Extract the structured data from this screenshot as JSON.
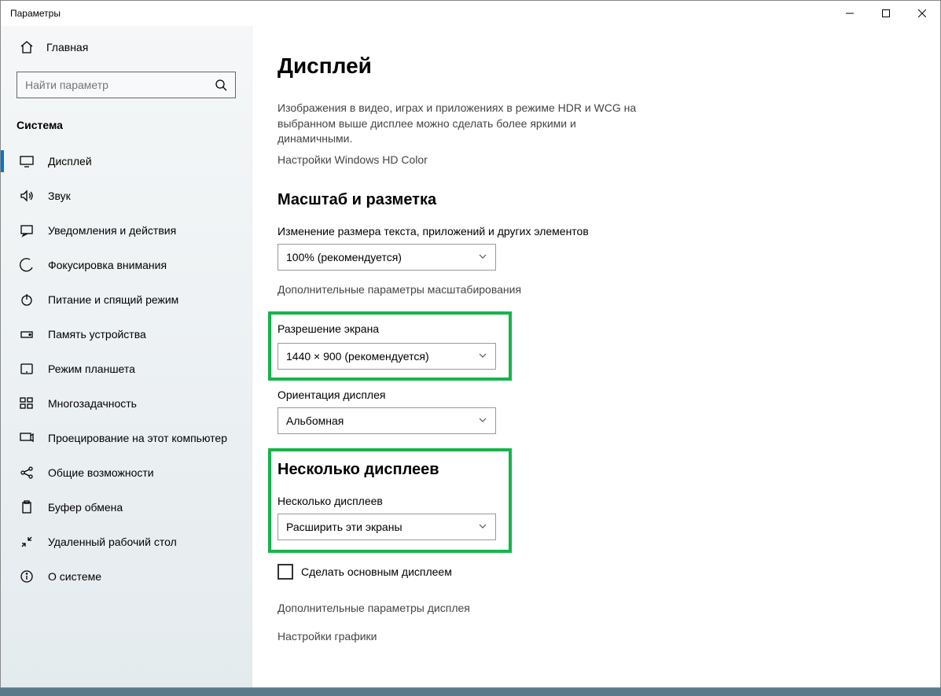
{
  "window": {
    "title": "Параметры"
  },
  "sidebar": {
    "home": "Главная",
    "search_placeholder": "Найти параметр",
    "category": "Система",
    "items": [
      {
        "label": "Дисплей",
        "icon": "display"
      },
      {
        "label": "Звук",
        "icon": "sound"
      },
      {
        "label": "Уведомления и действия",
        "icon": "notifications"
      },
      {
        "label": "Фокусировка внимания",
        "icon": "focus"
      },
      {
        "label": "Питание и спящий режим",
        "icon": "power"
      },
      {
        "label": "Память устройства",
        "icon": "storage"
      },
      {
        "label": "Режим планшета",
        "icon": "tablet"
      },
      {
        "label": "Многозадачность",
        "icon": "multitask"
      },
      {
        "label": "Проецирование на этот компьютер",
        "icon": "project"
      },
      {
        "label": "Общие возможности",
        "icon": "shared"
      },
      {
        "label": "Буфер обмена",
        "icon": "clipboard"
      },
      {
        "label": "Удаленный рабочий стол",
        "icon": "remote"
      },
      {
        "label": "О системе",
        "icon": "about"
      }
    ]
  },
  "content": {
    "title": "Дисплей",
    "hdr_desc": "Изображения в видео, играх и приложениях в режиме HDR и WCG на выбранном выше дисплее можно сделать более яркими и динамичными.",
    "hdr_link": "Настройки Windows HD Color",
    "scale_heading": "Масштаб и разметка",
    "scale_label": "Изменение размера текста, приложений и других элементов",
    "scale_value": "100% (рекомендуется)",
    "scale_link": "Дополнительные параметры масштабирования",
    "resolution_label": "Разрешение экрана",
    "resolution_value": "1440 × 900 (рекомендуется)",
    "orientation_label": "Ориентация дисплея",
    "orientation_value": "Альбомная",
    "multi_heading": "Несколько дисплеев",
    "multi_label": "Несколько дисплеев",
    "multi_value": "Расширить эти экраны",
    "make_primary": "Сделать основным дисплеем",
    "adv_display_link": "Дополнительные параметры дисплея",
    "graphics_link": "Настройки графики"
  }
}
